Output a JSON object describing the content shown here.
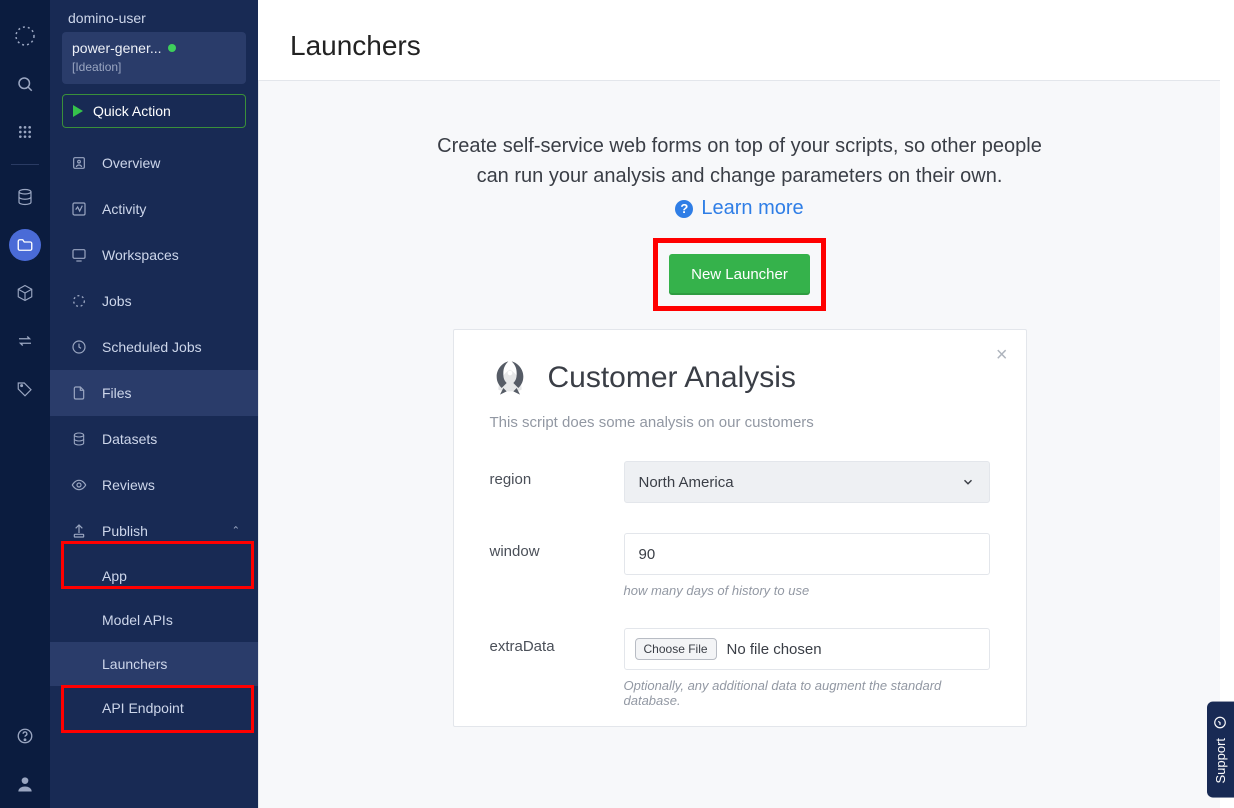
{
  "rail": {
    "icons": [
      "logo",
      "search",
      "apps",
      "database",
      "folder",
      "cube",
      "swap",
      "tag",
      "help",
      "user"
    ]
  },
  "sidebar": {
    "breadcrumb": "domino-user",
    "project_name": "power-gener...",
    "project_stage": "[Ideation]",
    "quick_action": "Quick Action",
    "items": [
      {
        "label": "Overview",
        "icon": "overview-icon"
      },
      {
        "label": "Activity",
        "icon": "activity-icon"
      },
      {
        "label": "Workspaces",
        "icon": "workspaces-icon"
      },
      {
        "label": "Jobs",
        "icon": "jobs-icon"
      },
      {
        "label": "Scheduled Jobs",
        "icon": "clock-icon"
      },
      {
        "label": "Files",
        "icon": "file-icon",
        "active": true
      },
      {
        "label": "Datasets",
        "icon": "datasets-icon"
      },
      {
        "label": "Reviews",
        "icon": "eye-icon"
      },
      {
        "label": "Publish",
        "icon": "publish-icon",
        "expandable": true,
        "highlight": true
      },
      {
        "label": "App",
        "sub": true
      },
      {
        "label": "Model APIs",
        "sub": true
      },
      {
        "label": "Launchers",
        "sub": true,
        "active": true,
        "highlight": true
      },
      {
        "label": "API Endpoint",
        "sub": true
      }
    ]
  },
  "page": {
    "title": "Launchers",
    "blurb": "Create self-service web forms on top of your scripts, so other people can run your analysis and change parameters on their own.",
    "learn_more": "Learn more",
    "new_launcher": "New Launcher"
  },
  "card": {
    "title": "Customer Analysis",
    "desc": "This script does some analysis on our customers",
    "fields": {
      "region": {
        "label": "region",
        "value": "North America"
      },
      "window": {
        "label": "window",
        "value": "90",
        "hint": "how many days of history to use"
      },
      "extra": {
        "label": "extraData",
        "button": "Choose File",
        "status": "No file chosen",
        "hint": "Optionally, any additional data to augment the standard database."
      }
    }
  },
  "support": "Support"
}
